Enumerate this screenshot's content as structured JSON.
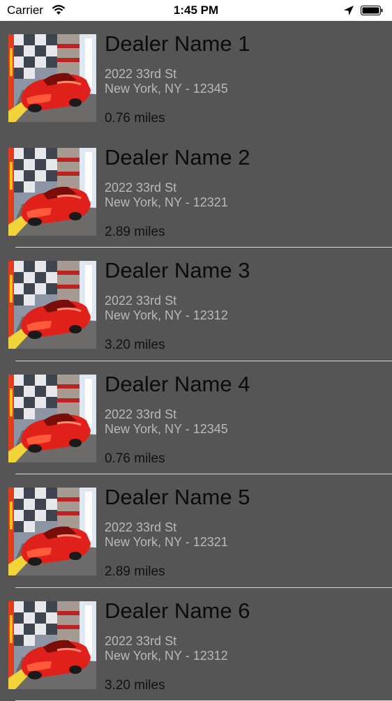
{
  "status_bar": {
    "carrier": "Carrier",
    "time": "1:45 PM",
    "icons": [
      "wifi-icon",
      "location-arrow-icon",
      "battery-icon"
    ]
  },
  "dealers": [
    {
      "name": "Dealer Name 1",
      "street": "2022 33rd St",
      "city": "New York, NY - 12345",
      "distance": "0.76 miles"
    },
    {
      "name": "Dealer Name 2",
      "street": "2022 33rd St",
      "city": "New York, NY - 12321",
      "distance": "2.89 miles"
    },
    {
      "name": "Dealer Name 3",
      "street": "2022 33rd St",
      "city": "New York, NY - 12312",
      "distance": "3.20 miles"
    },
    {
      "name": "Dealer Name 4",
      "street": "2022 33rd St",
      "city": "New York, NY - 12345",
      "distance": "0.76 miles"
    },
    {
      "name": "Dealer Name 5",
      "street": "2022 33rd St",
      "city": "New York, NY - 12321",
      "distance": "2.89 miles"
    },
    {
      "name": "Dealer Name 6",
      "street": "2022 33rd St",
      "city": "New York, NY - 12312",
      "distance": "3.20 miles"
    }
  ],
  "colors": {
    "background": "#555555",
    "name_text": "#0b0b0b",
    "address_text": "#b9b9b9",
    "separator": "#d9d9d9",
    "car_red": "#e0201a"
  }
}
